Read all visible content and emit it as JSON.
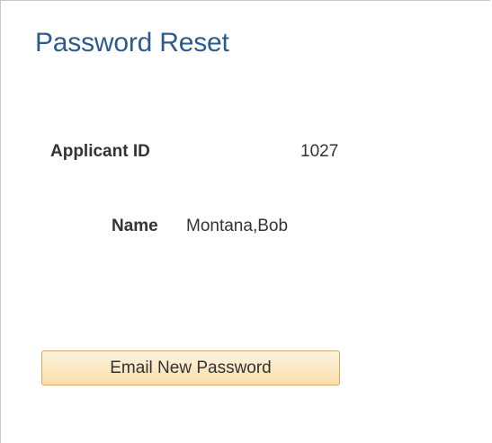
{
  "page": {
    "title": "Password Reset"
  },
  "fields": {
    "applicant_id": {
      "label": "Applicant ID",
      "value": "1027"
    },
    "name": {
      "label": "Name",
      "value": "Montana,Bob"
    }
  },
  "actions": {
    "email_button_label": "Email New Password"
  },
  "colors": {
    "title": "#2d5b8e",
    "text": "#333333",
    "button_border": "#d7a867",
    "button_top": "#fdf3df",
    "button_bottom": "#f9dfa9"
  }
}
